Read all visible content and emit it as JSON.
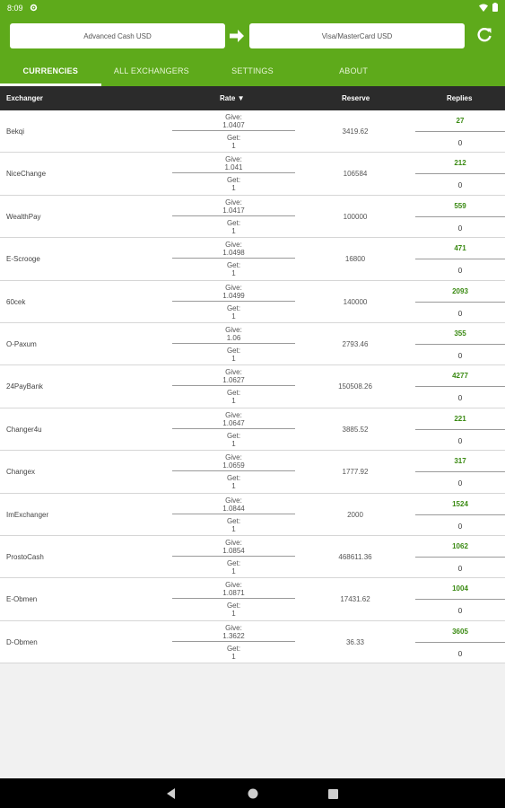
{
  "status": {
    "time": "8:09"
  },
  "header": {
    "from_currency": "Advanced Cash USD",
    "to_currency": "Visa/MasterCard USD",
    "colors": {
      "accent": "#5eaa1b",
      "dark": "#2b2b2b",
      "positive": "#3a8a12"
    }
  },
  "tabs": [
    {
      "label": "CURRENCIES",
      "active": true
    },
    {
      "label": "ALL EXCHANGERS",
      "active": false
    },
    {
      "label": "SETTINGS",
      "active": false
    },
    {
      "label": "ABOUT",
      "active": false
    }
  ],
  "columns": {
    "exchanger": "Exchanger",
    "rate": "Rate ▼",
    "reserve": "Reserve",
    "replies": "Replies"
  },
  "rows": [
    {
      "name": "Bekqi",
      "give": "1.0407",
      "get": "1",
      "reserve": "3419.62",
      "positive": "27",
      "negative": "0"
    },
    {
      "name": "NiceChange",
      "give": "1.041",
      "get": "1",
      "reserve": "106584",
      "positive": "212",
      "negative": "0"
    },
    {
      "name": "WealthPay",
      "give": "1.0417",
      "get": "1",
      "reserve": "100000",
      "positive": "559",
      "negative": "0"
    },
    {
      "name": "E-Scrooge",
      "give": "1.0498",
      "get": "1",
      "reserve": "16800",
      "positive": "471",
      "negative": "0"
    },
    {
      "name": "60cek",
      "give": "1.0499",
      "get": "1",
      "reserve": "140000",
      "positive": "2093",
      "negative": "0"
    },
    {
      "name": "O-Paxum",
      "give": "1.06",
      "get": "1",
      "reserve": "2793.46",
      "positive": "355",
      "negative": "0"
    },
    {
      "name": "24PayBank",
      "give": "1.0627",
      "get": "1",
      "reserve": "150508.26",
      "positive": "4277",
      "negative": "0"
    },
    {
      "name": "Changer4u",
      "give": "1.0647",
      "get": "1",
      "reserve": "3885.52",
      "positive": "221",
      "negative": "0"
    },
    {
      "name": "Changex",
      "give": "1.0659",
      "get": "1",
      "reserve": "1777.92",
      "positive": "317",
      "negative": "0"
    },
    {
      "name": "ImExchanger",
      "give": "1.0844",
      "get": "1",
      "reserve": "2000",
      "positive": "1524",
      "negative": "0"
    },
    {
      "name": "ProstoCash",
      "give": "1.0854",
      "get": "1",
      "reserve": "468611.36",
      "positive": "1062",
      "negative": "0"
    },
    {
      "name": "E-Obmen",
      "give": "1.0871",
      "get": "1",
      "reserve": "17431.62",
      "positive": "1004",
      "negative": "0"
    },
    {
      "name": "D-Obmen",
      "give": "1.3622",
      "get": "1",
      "reserve": "36.33",
      "positive": "3605",
      "negative": "0"
    }
  ],
  "labels": {
    "give": "Give:",
    "get": "Get:"
  }
}
